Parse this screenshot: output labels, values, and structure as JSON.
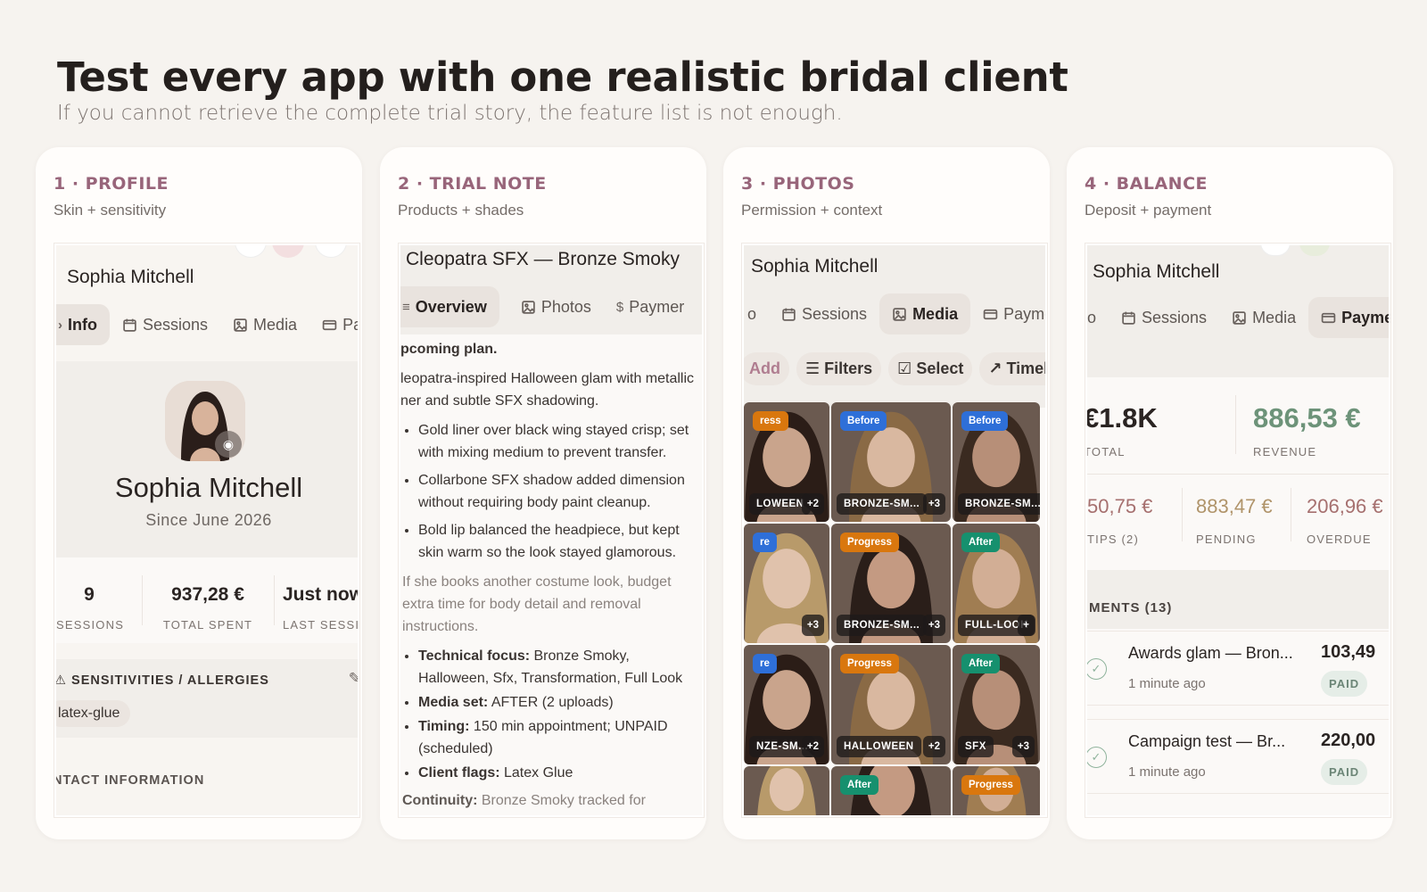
{
  "header": {
    "title": "Test every app with one realistic bridal client",
    "subtitle": "If you cannot retrieve the complete trial story, the feature list is not enough."
  },
  "cards": [
    {
      "step": "1 · PROFILE",
      "desc": "Skin + sensitivity"
    },
    {
      "step": "2 · TRIAL NOTE",
      "desc": "Products + shades"
    },
    {
      "step": "3 · PHOTOS",
      "desc": "Permission + context"
    },
    {
      "step": "4 · BALANCE",
      "desc": "Deposit + payment"
    }
  ],
  "profile": {
    "name": "Sophia Mitchell",
    "tabs": {
      "info": "Info",
      "sessions": "Sessions",
      "media": "Media",
      "pay": "Pay"
    },
    "big_name": "Sophia Mitchell",
    "since": "Since June 2026",
    "stats": [
      {
        "value": "9",
        "label": "SESSIONS"
      },
      {
        "value": "937,28 €",
        "label": "TOTAL SPENT"
      },
      {
        "value": "Just now",
        "label": "LAST SESSIO"
      }
    ],
    "sens_title": "SENSITIVITIES / ALLERGIES",
    "sens_chip": "latex-glue",
    "contact": "NTACT INFORMATION"
  },
  "trial": {
    "title": "Cleopatra SFX — Bronze Smoky",
    "tabs": {
      "overview": "Overview",
      "photos": "Photos",
      "payment": "Paymer"
    },
    "plan_heading": "pcoming plan.",
    "plan_text": "leopatra-inspired Halloween glam with metallic ner and subtle SFX shadowing.",
    "bullets": [
      "Gold liner over black wing stayed crisp; set with mixing medium to prevent transfer.",
      "Collarbone SFX shadow added dimension without requiring body paint cleanup.",
      "Bold lip balanced the headpiece, but kept skin warm so the look stayed glamorous."
    ],
    "followup": "If she books another costume look, budget extra time for body detail and removal instructions.",
    "facts": [
      {
        "k": "Technical focus:",
        "v": " Bronze Smoky, Halloween, Sfx, Transformation, Full Look"
      },
      {
        "k": "Media set:",
        "v": " AFTER (2 uploads)"
      },
      {
        "k": "Timing:",
        "v": " 150 min appointment; UNPAID (scheduled)"
      },
      {
        "k": "Client flags:",
        "v": " Latex Glue"
      }
    ],
    "continuity_k": "Continuity:",
    "continuity_v": " Bronze Smoky tracked for"
  },
  "photos": {
    "name": "Sophia Mitchell",
    "tabs": {
      "info": "o",
      "sessions": "Sessions",
      "media": "Media",
      "payment": "Paymer"
    },
    "actions": {
      "add": "Add",
      "filters": "Filters",
      "select": "Select",
      "timeline": "Timeli"
    },
    "grid": [
      {
        "badge": "ress",
        "tag": "LOWEEN",
        "count": "+2",
        "kind": "progress"
      },
      {
        "badge": "Before",
        "tag": "BRONZE-SM...",
        "count": "+3",
        "kind": "before"
      },
      {
        "badge": "Before",
        "tag": "BRONZE-SM...",
        "count": "",
        "kind": "before"
      },
      {
        "badge": "re",
        "tag": "",
        "count": "+3",
        "kind": "before"
      },
      {
        "badge": "Progress",
        "tag": "BRONZE-SM...",
        "count": "+3",
        "kind": "progress"
      },
      {
        "badge": "After",
        "tag": "FULL-LOOK",
        "count": "+",
        "kind": "after"
      },
      {
        "badge": "re",
        "tag": "NZE-SM...",
        "count": "+2",
        "kind": "before"
      },
      {
        "badge": "Progress",
        "tag": "HALLOWEEN",
        "count": "+2",
        "kind": "progress"
      },
      {
        "badge": "After",
        "tag": "SFX",
        "count": "+3",
        "kind": "after"
      },
      {
        "badge": "",
        "tag": "",
        "count": "",
        "kind": "before"
      },
      {
        "badge": "After",
        "tag": "",
        "count": "",
        "kind": "after"
      },
      {
        "badge": "Progress",
        "tag": "",
        "count": "",
        "kind": "progress"
      }
    ]
  },
  "balance": {
    "name": "Sophia Mitchell",
    "tabs": {
      "info": "o",
      "sessions": "Sessions",
      "media": "Media",
      "payment": "Paymer"
    },
    "total": "€1.8K",
    "total_lbl": "TOTAL",
    "revenue": "886,53 €",
    "revenue_lbl": "REVENUE",
    "tips": "50,75 €",
    "tips_lbl": "TIPS (2)",
    "pending": "883,47 €",
    "pending_lbl": "PENDING",
    "overdue": "206,96 €",
    "overdue_lbl": "OVERDUE",
    "payments_lbl": "MENTS (13)",
    "rows": [
      {
        "title": "Awards glam — Bron...",
        "time": "1 minute ago",
        "amount": "103,49",
        "status": "PAID"
      },
      {
        "title": "Campaign test — Br...",
        "time": "1 minute ago",
        "amount": "220,00",
        "status": "PAID"
      }
    ]
  },
  "colors": {
    "accent": "#98657a",
    "revenue": "#6d9379",
    "pending": "#b0946a",
    "overdue": "#a6706f",
    "before": "#2e6fd8",
    "progress": "#d9770e",
    "after": "#16906e"
  }
}
